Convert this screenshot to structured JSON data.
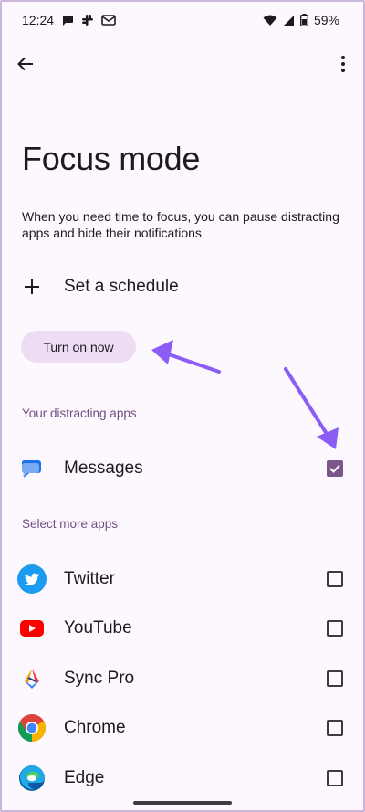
{
  "status_bar": {
    "time": "12:24",
    "battery": "59%",
    "left_icons": [
      "chat-bubble-icon",
      "slack-icon",
      "grid-message-icon"
    ],
    "right_icons": [
      "wifi-icon",
      "signal-icon",
      "battery-icon"
    ]
  },
  "app_bar": {
    "back_icon": "arrow-back-icon",
    "menu_icon": "more-vert-icon"
  },
  "page": {
    "title": "Focus mode",
    "description": "When you need time to focus, you can pause distracting apps and hide their notifications",
    "schedule_label": "Set a schedule",
    "turn_on_label": "Turn on now"
  },
  "sections": {
    "distracting_header": "Your distracting apps",
    "more_header": "Select more apps"
  },
  "distracting_apps": [
    {
      "label": "Messages",
      "icon": "messages-icon",
      "checked": true
    }
  ],
  "more_apps": [
    {
      "label": "Twitter",
      "icon": "twitter-icon",
      "checked": false
    },
    {
      "label": "YouTube",
      "icon": "youtube-icon",
      "checked": false
    },
    {
      "label": "Sync Pro",
      "icon": "sync-pro-icon",
      "checked": false
    },
    {
      "label": "Chrome",
      "icon": "chrome-icon",
      "checked": false
    },
    {
      "label": "Edge",
      "icon": "edge-icon",
      "checked": false
    }
  ],
  "colors": {
    "background": "#fdf8fd",
    "accent": "#7a568a",
    "tonal_button": "#ecdcf4",
    "section_header": "#6f4f86",
    "annotation_arrow": "#8b5cf6"
  }
}
